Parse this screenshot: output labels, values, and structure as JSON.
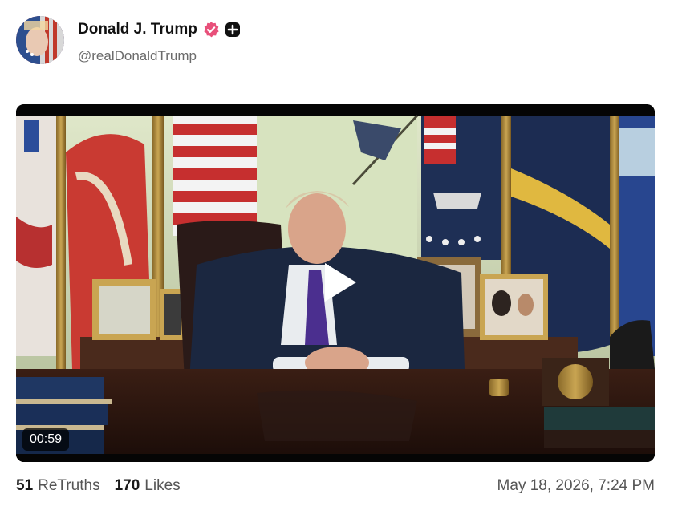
{
  "post": {
    "author": {
      "display_name": "Donald J. Trump",
      "handle": "@realDonaldTrump",
      "verified_icon": "verified-badge-icon",
      "badge_icon": "plus-badge-icon",
      "verified_color": "#e8507a"
    },
    "media": {
      "type": "video",
      "duration": "00:59",
      "play_icon": "play-icon"
    },
    "stats": {
      "retruths_count": "51",
      "retruths_label": "ReTruths",
      "likes_count": "170",
      "likes_label": "Likes"
    },
    "timestamp": "May 18, 2026, 7:24 PM"
  }
}
